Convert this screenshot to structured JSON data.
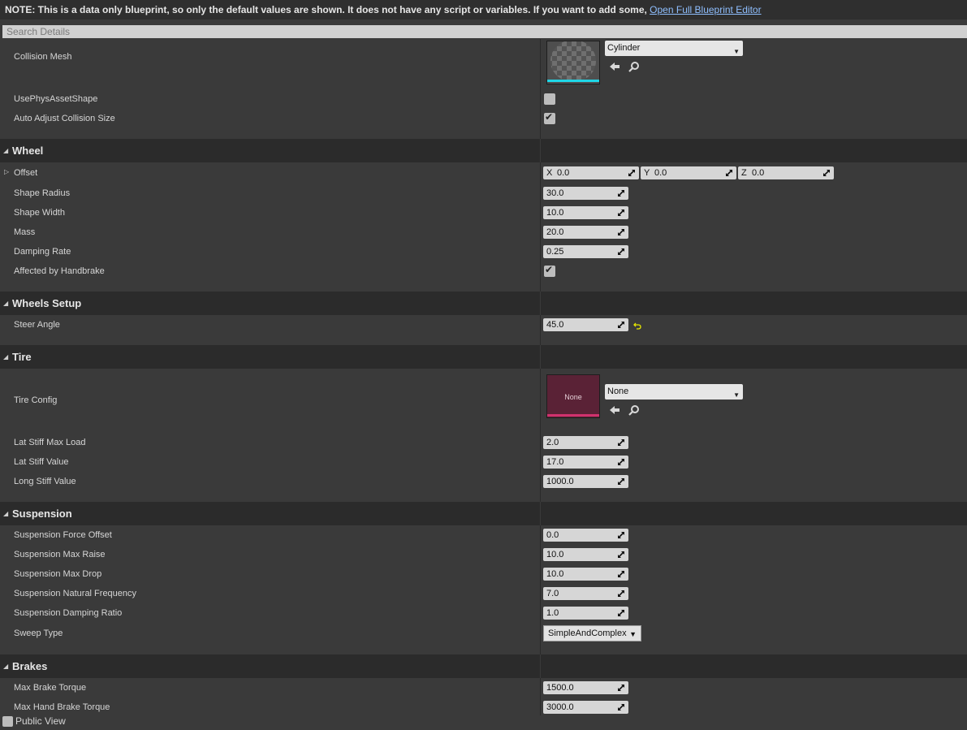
{
  "note": {
    "text": "NOTE: This is a data only blueprint, so only the default values are shown.  It does not have any script or variables.  If you want to add some,",
    "link": "Open Full Blueprint Editor"
  },
  "search": {
    "placeholder": "Search Details"
  },
  "collision": {
    "mesh_label": "Collision Mesh",
    "mesh_value": "Cylinder",
    "use_phys_label": "UsePhysAssetShape",
    "use_phys_checked": false,
    "auto_adjust_label": "Auto Adjust Collision Size",
    "auto_adjust_checked": true
  },
  "wheel": {
    "title": "Wheel",
    "offset_label": "Offset",
    "offset": {
      "x_axis": "X",
      "x": "0.0",
      "y_axis": "Y",
      "y": "0.0",
      "z_axis": "Z",
      "z": "0.0"
    },
    "shape_radius_label": "Shape Radius",
    "shape_radius": "30.0",
    "shape_width_label": "Shape Width",
    "shape_width": "10.0",
    "mass_label": "Mass",
    "mass": "20.0",
    "damping_label": "Damping Rate",
    "damping": "0.25",
    "handbrake_label": "Affected by Handbrake",
    "handbrake_checked": true
  },
  "wheels_setup": {
    "title": "Wheels Setup",
    "steer_label": "Steer Angle",
    "steer": "45.0"
  },
  "tire": {
    "title": "Tire",
    "config_label": "Tire Config",
    "thumb_text": "None",
    "config_value": "None",
    "lat_max_label": "Lat Stiff Max Load",
    "lat_max": "2.0",
    "lat_val_label": "Lat Stiff Value",
    "lat_val": "17.0",
    "long_label": "Long Stiff Value",
    "long_val": "1000.0"
  },
  "suspension": {
    "title": "Suspension",
    "force_offset_label": "Suspension Force Offset",
    "force_offset": "0.0",
    "max_raise_label": "Suspension Max Raise",
    "max_raise": "10.0",
    "max_drop_label": "Suspension Max Drop",
    "max_drop": "10.0",
    "nat_freq_label": "Suspension Natural Frequency",
    "nat_freq": "7.0",
    "damp_ratio_label": "Suspension Damping Ratio",
    "damp_ratio": "1.0",
    "sweep_label": "Sweep Type",
    "sweep_value": "SimpleAndComplex"
  },
  "brakes": {
    "title": "Brakes",
    "max_brake_label": "Max Brake Torque",
    "max_brake": "1500.0",
    "hand_brake_label": "Max Hand Brake Torque",
    "hand_brake": "3000.0"
  },
  "public_view": {
    "label": "Public View",
    "checked": false
  },
  "colors": {
    "panel_bg": "#3a3a3a",
    "category_bg": "#2b2b2b",
    "mesh_thumb_accent": "#1fd6e6",
    "tire_thumb_bg": "#5a2236",
    "tire_thumb_accent": "#d0326e",
    "link": "#8fbfff"
  }
}
